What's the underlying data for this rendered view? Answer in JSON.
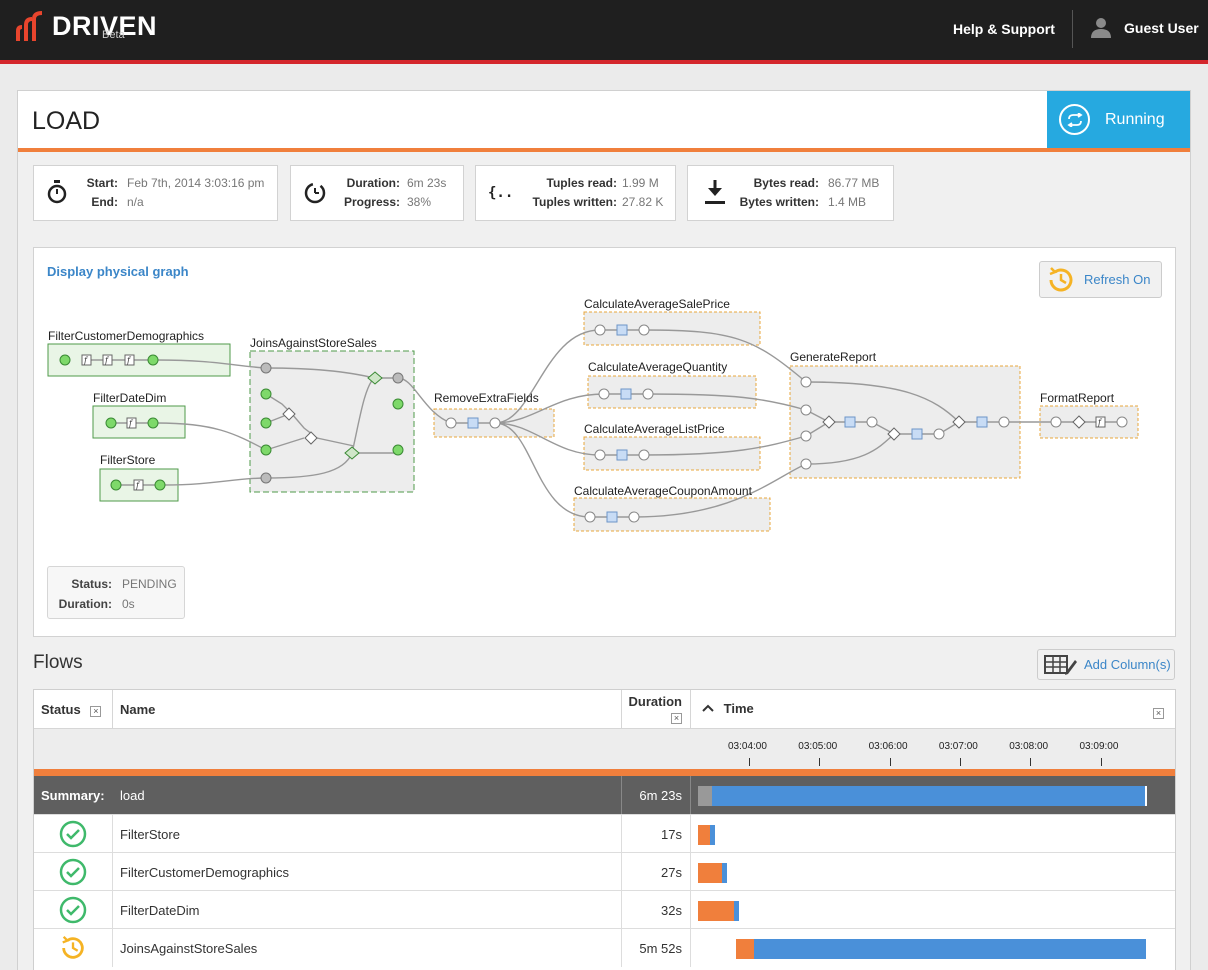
{
  "header": {
    "brand": "DRIVEN",
    "brand_sub": "Beta",
    "help_link": "Help & Support",
    "user_name": "Guest User"
  },
  "page": {
    "title": "LOAD",
    "status": "Running",
    "accent_color": "#26a9e0",
    "stripe_color": "#f07f3c"
  },
  "stats": {
    "start_label": "Start:",
    "start_value": "Feb 7th, 2014 3:03:16 pm",
    "end_label": "End:",
    "end_value": "n/a",
    "duration_label": "Duration:",
    "duration_value": "6m  23s",
    "progress_label": "Progress:",
    "progress_value": "38%",
    "tuples_read_label": "Tuples read:",
    "tuples_read_value": "1.99 M",
    "tuples_written_label": "Tuples written:",
    "tuples_written_value": "27.82 K",
    "bytes_read_label": "Bytes read:",
    "bytes_read_value": "86.77 MB",
    "bytes_written_label": "Bytes written:",
    "bytes_written_value": "1.4 MB"
  },
  "graph": {
    "link": "Display physical graph",
    "refresh": "Refresh On",
    "nodes": {
      "filter_customer": "FilterCustomerDemographics",
      "filter_date": "FilterDateDim",
      "filter_store": "FilterStore",
      "joins": "JoinsAgainstStoreSales",
      "remove": "RemoveExtraFields",
      "avg_sale": "CalculateAverageSalePrice",
      "avg_qty": "CalculateAverageQuantity",
      "avg_list": "CalculateAverageListPrice",
      "avg_coupon": "CalculateAverageCouponAmount",
      "generate": "GenerateReport",
      "format": "FormatReport"
    },
    "pending": {
      "status_label": "Status:",
      "status_value": "PENDING",
      "duration_label": "Duration:",
      "duration_value": "0s"
    }
  },
  "flows": {
    "title": "Flows",
    "add_columns": "Add Column(s)",
    "headers": {
      "status": "Status",
      "name": "Name",
      "duration": "Duration",
      "time": "Time"
    },
    "ticks": [
      "03:04:00",
      "03:05:00",
      "03:06:00",
      "03:07:00",
      "03:08:00",
      "03:09:00"
    ],
    "summary": {
      "label": "Summary:",
      "name": "load",
      "duration": "6m  23s"
    },
    "rows": [
      {
        "name": "FilterStore",
        "duration": "17s",
        "status": "complete-icon"
      },
      {
        "name": "FilterCustomerDemographics",
        "duration": "27s",
        "status": "complete-icon"
      },
      {
        "name": "FilterDateDim",
        "duration": "32s",
        "status": "complete-icon"
      },
      {
        "name": "JoinsAgainstStoreSales",
        "duration": "5m  52s",
        "status": "running-icon"
      }
    ]
  }
}
